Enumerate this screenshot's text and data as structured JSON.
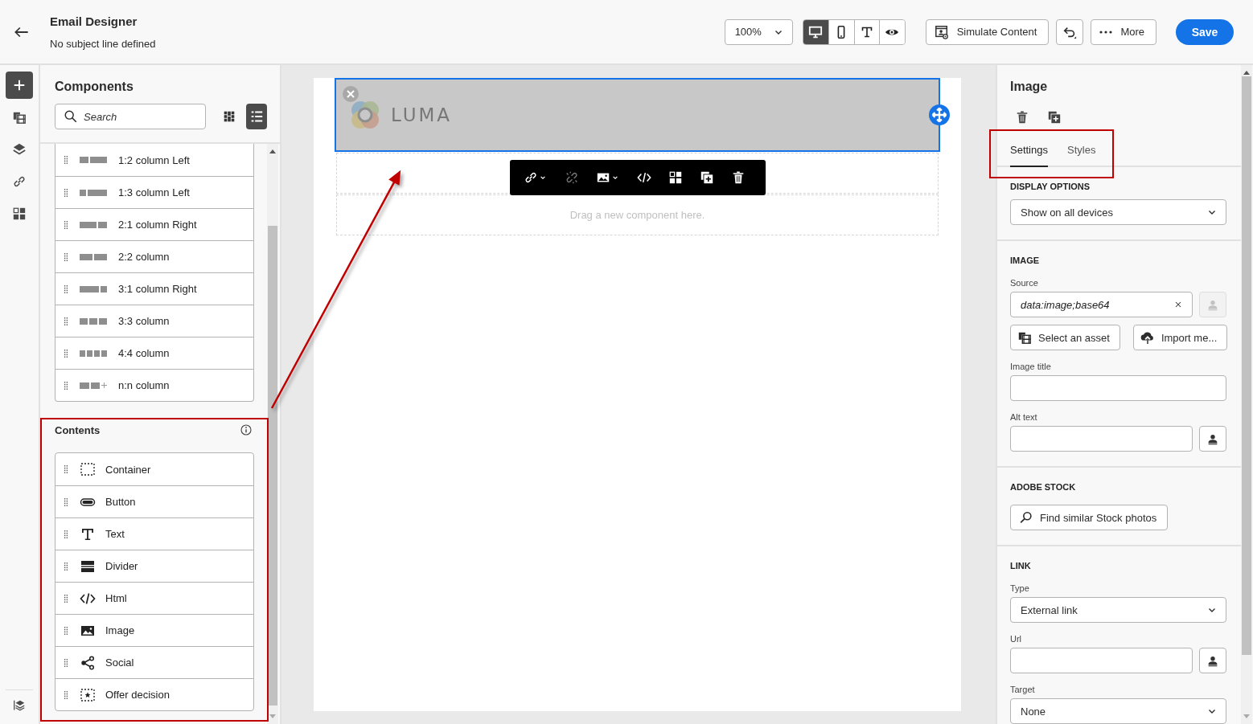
{
  "header": {
    "title": "Email Designer",
    "subtitle": "No subject line defined",
    "zoom": "100%",
    "view_modes": [
      {
        "kind": "desktop",
        "selected": true
      },
      {
        "kind": "mobile",
        "selected": false
      },
      {
        "kind": "text",
        "selected": false
      },
      {
        "kind": "preview",
        "selected": false
      }
    ],
    "buttons": [
      {
        "kind": "simulate",
        "label": "Simulate Content"
      },
      {
        "kind": "undo"
      },
      {
        "kind": "more",
        "label": "More"
      },
      {
        "kind": "save",
        "label": "Save"
      }
    ]
  },
  "rail": {
    "items": [
      {
        "kind": "add",
        "selected": true
      },
      {
        "kind": "assets",
        "selected": false
      },
      {
        "kind": "layers",
        "selected": false
      },
      {
        "kind": "links",
        "selected": false
      },
      {
        "kind": "fragments",
        "selected": false
      }
    ],
    "footer": [
      {
        "kind": "layer-settings"
      }
    ]
  },
  "components": {
    "title": "Components",
    "search": {
      "placeholder": "Search"
    },
    "views": [
      {
        "kind": "grid",
        "selected": false
      },
      {
        "kind": "list",
        "selected": true
      }
    ],
    "structures": [
      {
        "kind": "c12",
        "label": "1:2 column Left"
      },
      {
        "kind": "c13",
        "label": "1:3 column Left"
      },
      {
        "kind": "c21",
        "label": "2:1 column Right"
      },
      {
        "kind": "c22",
        "label": "2:2 column"
      },
      {
        "kind": "c31",
        "label": "3:1 column Right"
      },
      {
        "kind": "c33",
        "label": "3:3 column"
      },
      {
        "kind": "c44",
        "label": "4:4 column"
      },
      {
        "kind": "cnn",
        "label": "n:n column"
      }
    ]
  },
  "contents": {
    "title": "Contents",
    "items": [
      {
        "kind": "container",
        "label": "Container"
      },
      {
        "kind": "button",
        "label": "Button"
      },
      {
        "kind": "text",
        "label": "Text"
      },
      {
        "kind": "divider",
        "label": "Divider"
      },
      {
        "kind": "html",
        "label": "Html"
      },
      {
        "kind": "image",
        "label": "Image"
      },
      {
        "kind": "social",
        "label": "Social"
      },
      {
        "kind": "offer",
        "label": "Offer decision"
      }
    ]
  },
  "canvas": {
    "logo": "LUMA",
    "placeholder": "Drag a new component here.",
    "toolbar": [
      {
        "kind": "link",
        "menu": true,
        "disabled": false
      },
      {
        "kind": "unlink",
        "menu": false,
        "disabled": true
      },
      {
        "kind": "image",
        "menu": true,
        "disabled": false
      },
      {
        "kind": "code",
        "menu": false,
        "disabled": false
      },
      {
        "kind": "grid",
        "menu": false,
        "disabled": false
      },
      {
        "kind": "duplicate",
        "menu": false,
        "disabled": false
      },
      {
        "kind": "delete",
        "menu": false,
        "disabled": false
      }
    ]
  },
  "properties": {
    "title": "Image",
    "tabs": [
      {
        "label": "Settings",
        "selected": true
      },
      {
        "label": "Styles",
        "selected": false
      }
    ],
    "display_options": {
      "heading": "DISPLAY OPTIONS",
      "value": "Show on all devices"
    },
    "image": {
      "heading": "IMAGE",
      "source_label": "Source",
      "source_value": "data:image;base64",
      "source_picker_disabled": true,
      "select_button": "Select an asset",
      "import_button": "Import me...",
      "title_label": "Image title",
      "alt_label": "Alt text"
    },
    "stock": {
      "heading": "ADOBE STOCK",
      "button": "Find similar Stock photos"
    },
    "link": {
      "heading": "LINK",
      "type_label": "Type",
      "type_value": "External link",
      "url_label": "Url",
      "target_label": "Target",
      "target_value": "None"
    }
  },
  "annotations": [
    {
      "kind": "box"
    },
    {
      "kind": "box"
    },
    {
      "kind": "arrow"
    }
  ]
}
